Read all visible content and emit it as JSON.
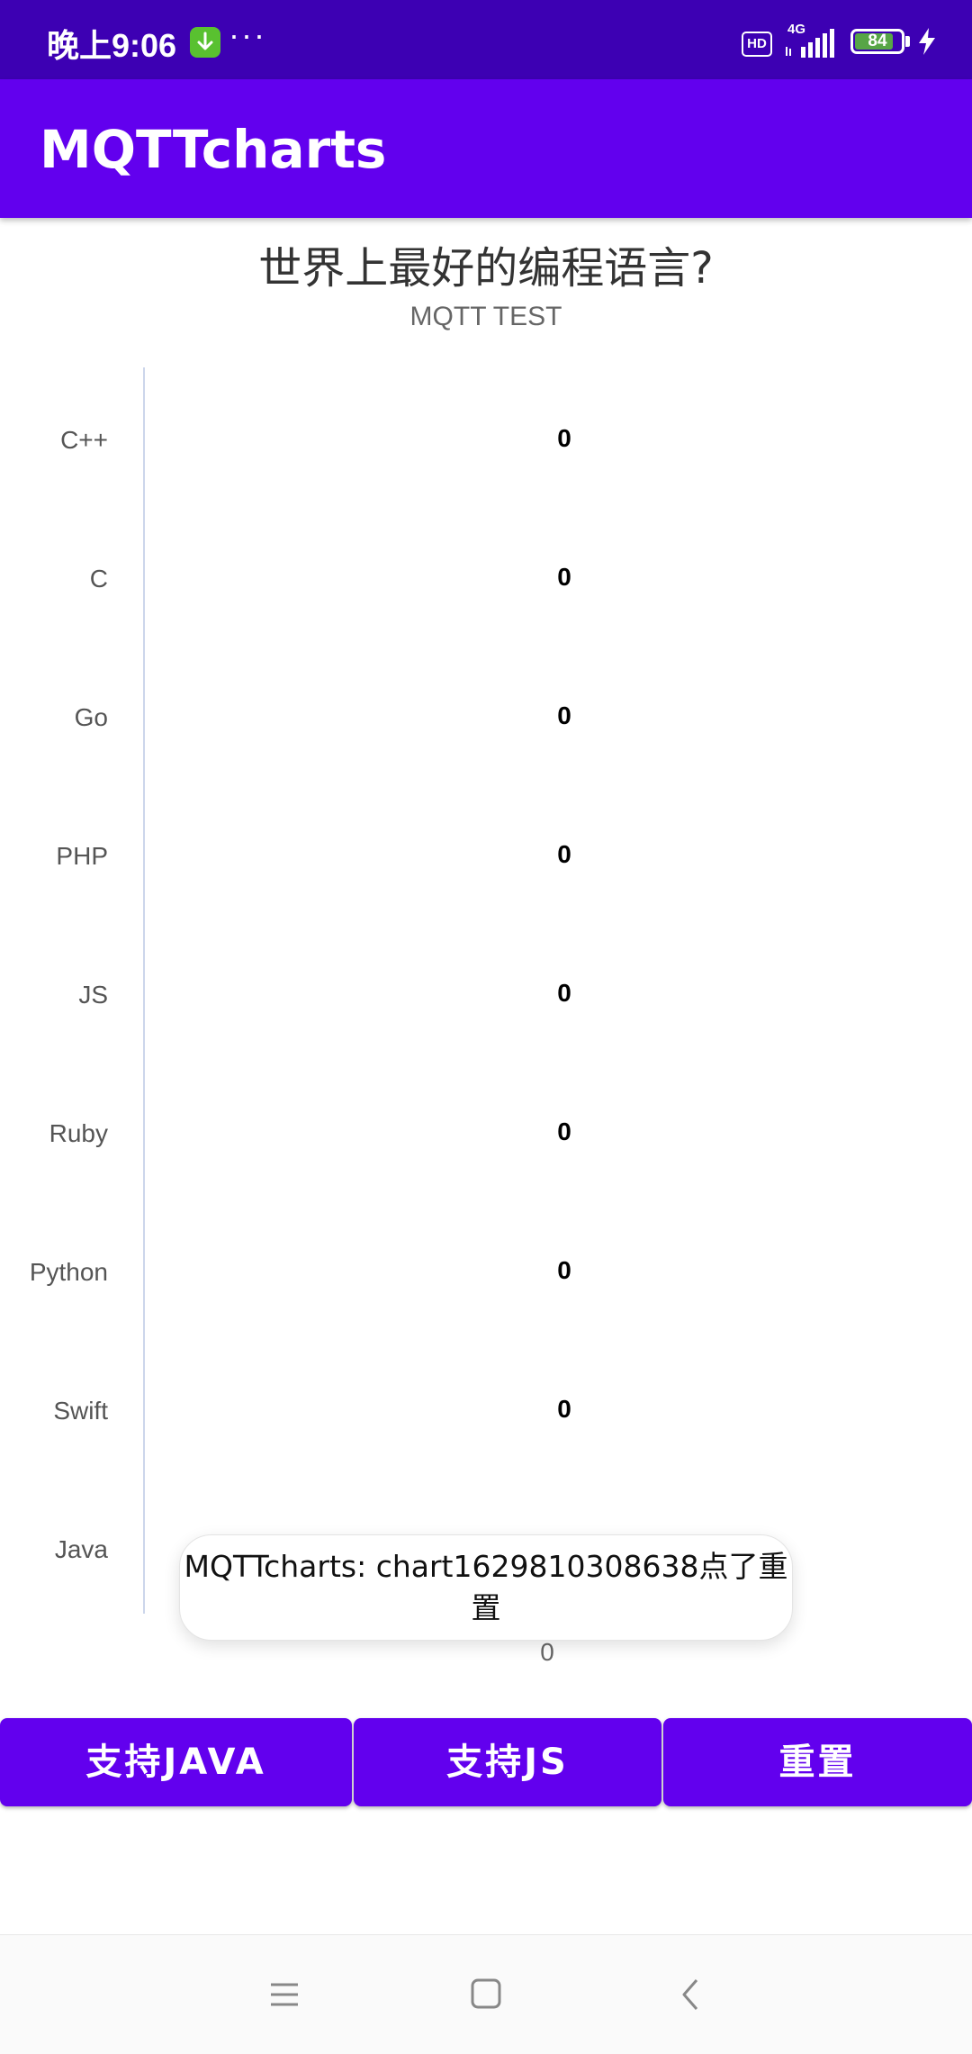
{
  "status_bar": {
    "time": "晚上9:06",
    "dots": "···",
    "hd": "HD",
    "network": "4G",
    "battery": "84",
    "battery_level": 0.84,
    "colors": {
      "background": "#3d00b3",
      "battery": "#5cc232",
      "download_badge": "#59c130"
    },
    "icons": [
      "download-icon",
      "signal-icon",
      "battery-icon",
      "charging-bolt-icon"
    ]
  },
  "app_bar": {
    "title": "MQTTcharts",
    "color": "#6200ee"
  },
  "chart_data": {
    "type": "bar",
    "orientation": "horizontal",
    "title": "世界上最好的编程语言?",
    "subtitle": "MQTT TEST",
    "categories": [
      "C++",
      "C",
      "Go",
      "PHP",
      "JS",
      "Ruby",
      "Python",
      "Swift",
      "Java"
    ],
    "values": [
      0,
      0,
      0,
      0,
      0,
      0,
      0,
      0,
      0
    ],
    "data_labels": [
      "0",
      "0",
      "0",
      "0",
      "0",
      "0",
      "0",
      "0",
      "0"
    ],
    "x_tick_labels": [
      "0"
    ],
    "grid": false,
    "legend": "none"
  },
  "toast": {
    "text": "MQTTcharts: chart1629810308638点了重置"
  },
  "buttons": [
    {
      "label": "支持JAVA"
    },
    {
      "label": "支持JS"
    },
    {
      "label": "重置"
    }
  ],
  "nav_bar": {
    "icons": [
      "menu-icon",
      "home-icon",
      "back-icon"
    ]
  }
}
